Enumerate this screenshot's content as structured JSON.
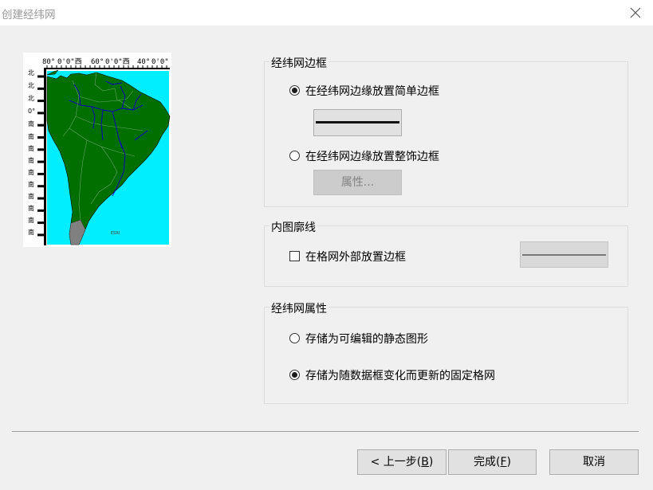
{
  "window": {
    "title": "创建经纬网",
    "close_icon": "close-icon"
  },
  "preview": {
    "map_colors": {
      "ocean": "#00eeff",
      "land": "#006f00",
      "rivers": "#0000c0",
      "borders": "#66aa66",
      "frame": "#000000"
    },
    "top_labels": [
      "80°",
      "0'0\"西",
      "60°",
      "0'0\"西",
      "40°",
      "0'0\""
    ],
    "left_labels": [
      "北",
      "北",
      "北",
      "0°",
      "南",
      "南",
      "南",
      "南",
      "南",
      "南",
      "南",
      "南",
      "南",
      "南"
    ]
  },
  "border_group": {
    "legend": "经纬网边框",
    "simple_border_label": "在经纬网边缘放置简单边框",
    "simple_border_selected": true,
    "fancy_border_label": "在经纬网边缘放置整饰边框",
    "fancy_border_selected": false,
    "properties_button": "属性..."
  },
  "neatline_group": {
    "legend": "内图廓线",
    "checkbox_label": "在格网外部放置边框",
    "checked": false
  },
  "graticule_properties": {
    "legend": "经纬网属性",
    "static_label": "存储为可编辑的静态图形",
    "static_selected": false,
    "dynamic_label": "存储为随数据框变化而更新的固定格网",
    "dynamic_selected": true
  },
  "footer": {
    "back": {
      "text": "< 上一步(",
      "key": "B",
      "end": ")"
    },
    "finish": {
      "text": "完成(",
      "key": "F",
      "end": ")"
    },
    "cancel": "取消"
  }
}
